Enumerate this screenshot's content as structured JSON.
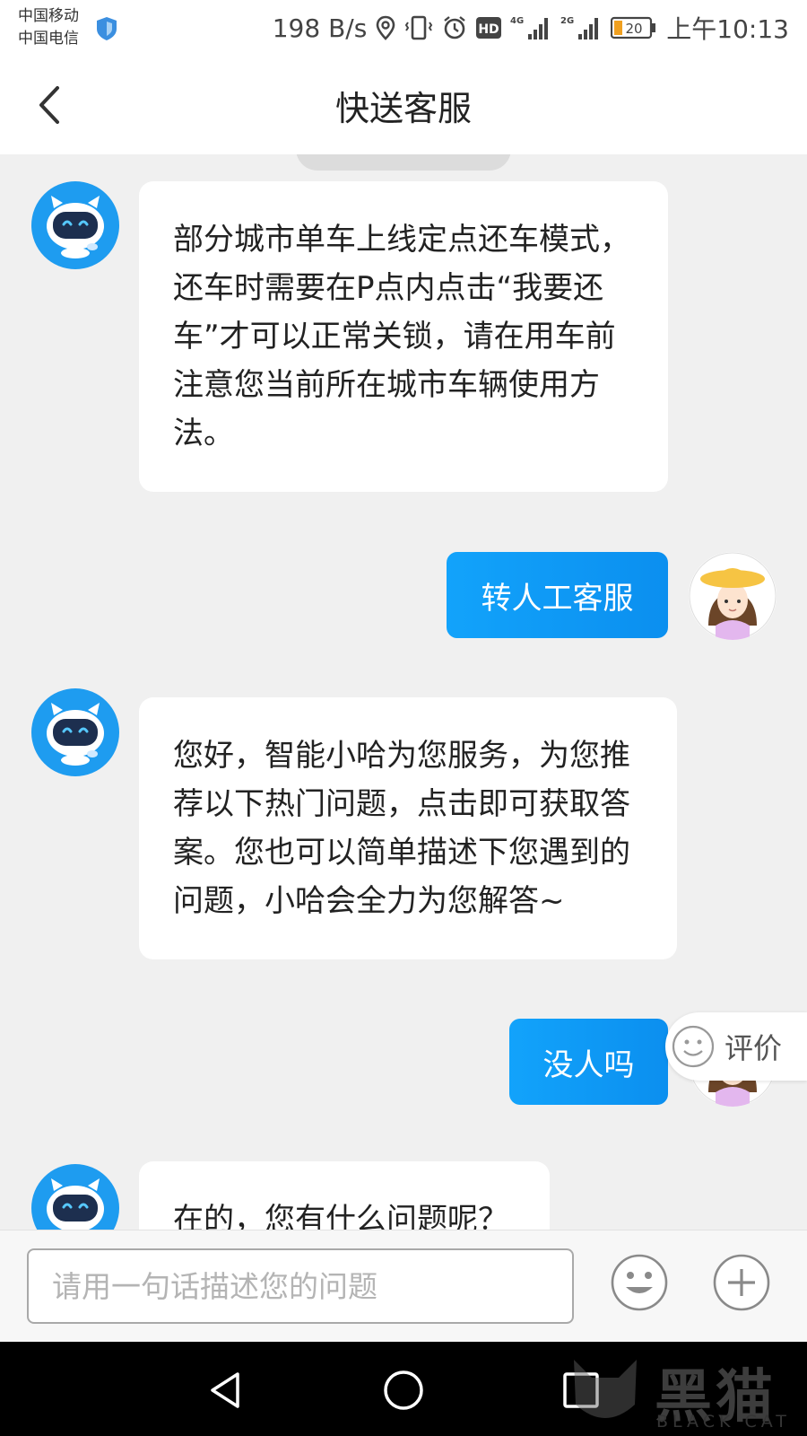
{
  "status_bar": {
    "carrier_1": "中国移动",
    "carrier_2": "中国电信",
    "net_speed": "198 B/s",
    "network_1": "4G",
    "network_2": "2G",
    "hd_badge": "HD",
    "battery": "20",
    "time": "上午10:13"
  },
  "header": {
    "title": "快送客服"
  },
  "messages": [
    {
      "sender": "bot",
      "text": "部分城市单车上线定点还车模式，还车时需要在P点内点击“我要还车”才可以正常关锁，请在用车前注意您当前所在城市车辆使用方法。"
    },
    {
      "sender": "user",
      "text": "转人工客服"
    },
    {
      "sender": "bot",
      "text": "您好，智能小哈为您服务，为您推荐以下热门问题，点击即可获取答案。您也可以简单描述下您遇到的问题，小哈会全力为您解答~"
    },
    {
      "sender": "user",
      "text": "没人吗"
    },
    {
      "sender": "bot",
      "text": "在的，您有什么问题呢？"
    }
  ],
  "rating": {
    "label": "评价"
  },
  "input": {
    "placeholder": "请用一句话描述您的问题"
  },
  "watermark": {
    "text": "黑猫",
    "sub": "BLACK CAT"
  },
  "colors": {
    "accent": "#0B95F0",
    "bot_avatar": "#1E9CF0",
    "background": "#F0F0F0"
  },
  "icons": [
    "shield-icon",
    "location-icon",
    "vibrate-icon",
    "alarm-icon",
    "signal-icon",
    "battery-icon",
    "back-arrow-icon",
    "robot-icon",
    "user-avatar-icon",
    "smiley-icon",
    "plus-icon",
    "back-triangle-icon",
    "home-circle-icon",
    "recents-square-icon"
  ]
}
